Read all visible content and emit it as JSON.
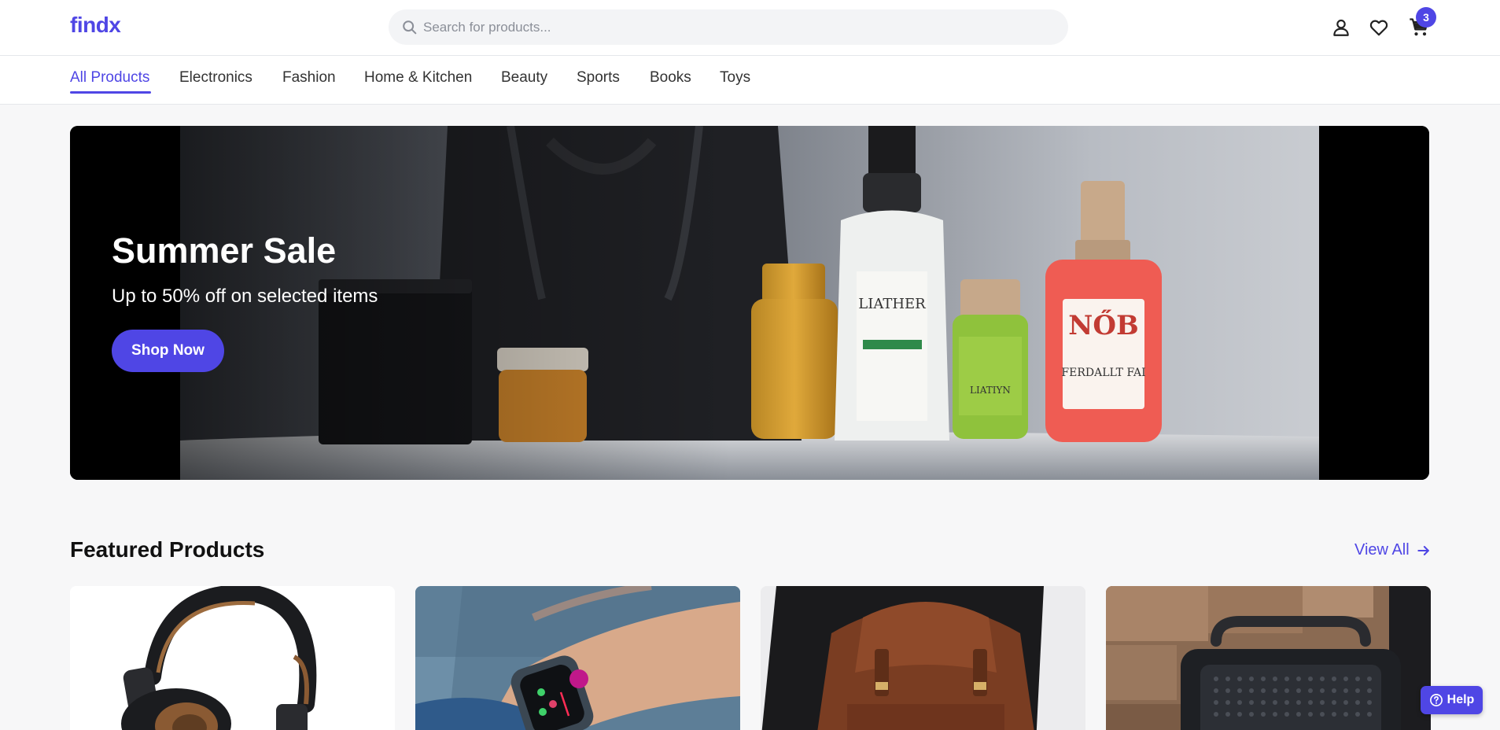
{
  "header": {
    "logo": "findx",
    "search_placeholder": "Search for products...",
    "cart_count": "3"
  },
  "categories": [
    {
      "label": "All Products",
      "active": true
    },
    {
      "label": "Electronics"
    },
    {
      "label": "Fashion"
    },
    {
      "label": "Home & Kitchen"
    },
    {
      "label": "Beauty"
    },
    {
      "label": "Sports"
    },
    {
      "label": "Books"
    },
    {
      "label": "Toys"
    }
  ],
  "hero": {
    "title": "Summer Sale",
    "subtitle": "Up to 50% off on selected items",
    "cta": "Shop Now",
    "product_labels": [
      "LIATHER",
      "LIATIYN",
      "NŐB",
      "FERDALLT FAI"
    ]
  },
  "featured": {
    "title": "Featured Products",
    "view_all": "View All"
  },
  "help": {
    "label": "Help"
  },
  "colors": {
    "accent": "#4f46e5"
  }
}
